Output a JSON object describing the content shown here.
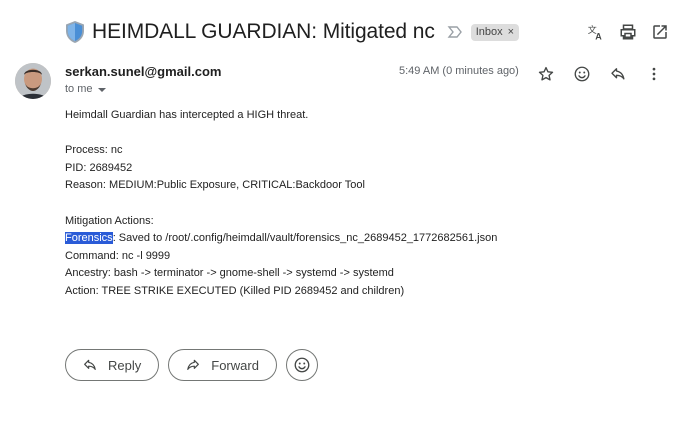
{
  "email": {
    "subject_emoji": "🛡️",
    "subject": "HEIMDALL GUARDIAN: Mitigated nc",
    "label_chip": "Inbox",
    "label_chip_close": "×",
    "sender": "serkan.sunel@gmail.com",
    "recipient": "to me",
    "timestamp": "5:49 AM (0 minutes ago)",
    "body": {
      "intro": "Heimdall Guardian has intercepted a HIGH threat.",
      "process": "Process: nc",
      "pid": "PID: 2689452",
      "reason": "Reason: MEDIUM:Public Exposure, CRITICAL:Backdoor Tool",
      "mitigation_header": "Mitigation Actions:",
      "forensics_label": "Forensics",
      "forensics_rest": ": Saved to /root/.config/heimdall/vault/forensics_nc_2689452_1772682561.json",
      "command": "Command: nc -l 9999",
      "ancestry": "Ancestry: bash -> terminator -> gnome-shell -> systemd -> systemd",
      "action": "Action: TREE STRIKE EXECUTED (Killed PID 2689452 and children)"
    }
  },
  "buttons": {
    "reply": "Reply",
    "forward": "Forward"
  },
  "icons": {
    "top": [
      "translate-icon",
      "print-icon",
      "open-in-new-window-icon"
    ],
    "message": [
      "star-icon",
      "emoji-reaction-icon",
      "reply-icon",
      "more-vert-icon"
    ]
  },
  "colors": {
    "selection": "#2a5bd7",
    "chip_bg": "#dddddd",
    "shield_blue": "#4a8fd6"
  }
}
